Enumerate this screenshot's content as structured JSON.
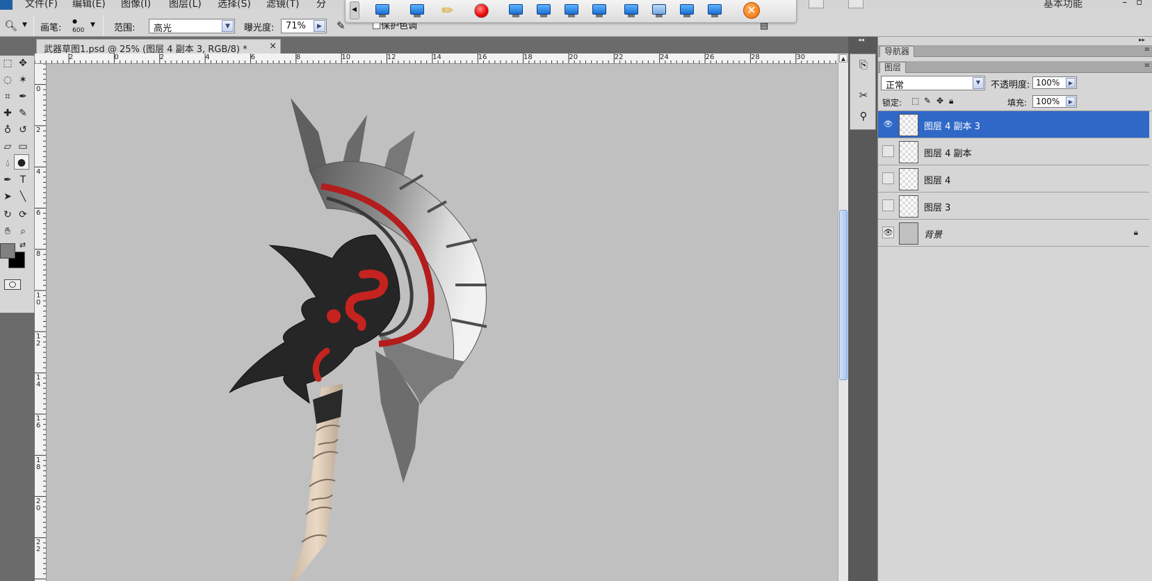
{
  "menu": [
    "文件(F)",
    "编辑(E)",
    "图像(I)",
    "图层(L)",
    "选择(S)",
    "滤镜(T)",
    "分"
  ],
  "workspace": "基本功能",
  "options": {
    "brush_label": "画笔:",
    "brush_size": "600",
    "range_label": "范围:",
    "range_value": "高光",
    "exposure_label": "曝光度:",
    "exposure_value": "71%",
    "protect_tones": "保护色调"
  },
  "document": {
    "tab_title": "武器草图1.psd @ 25% (图层 4 副本 3, RGB/8) *",
    "close": "×"
  },
  "rulers": {
    "horizontal": [
      "2",
      "0",
      "2",
      "4",
      "6",
      "8",
      "10",
      "12",
      "14",
      "16",
      "18",
      "20",
      "22",
      "24",
      "26",
      "28",
      "30"
    ],
    "vertical": [
      "0",
      "2",
      "4",
      "6",
      "8",
      "10",
      "12",
      "14",
      "16",
      "18",
      "20",
      "22"
    ]
  },
  "panels": {
    "navigator_tab": "导航器",
    "layers_tab": "图层",
    "blend_mode": "正常",
    "opacity_label": "不透明度:",
    "opacity_value": "100%",
    "lock_label": "锁定:",
    "fill_label": "填充:",
    "fill_value": "100%",
    "layers": [
      {
        "name": "图层 4 副本 3",
        "visible": true,
        "selected": true
      },
      {
        "name": "图层 4 副本",
        "visible": false,
        "selected": false
      },
      {
        "name": "图层 4",
        "visible": false,
        "selected": false
      },
      {
        "name": "图层 3",
        "visible": false,
        "selected": false
      },
      {
        "name": "背景",
        "visible": true,
        "selected": false,
        "locked": true
      }
    ]
  },
  "colors": {
    "selection": "#2f68c7",
    "canvas": "#c0c0c0",
    "foreground": "#808080",
    "background": "#000000"
  }
}
